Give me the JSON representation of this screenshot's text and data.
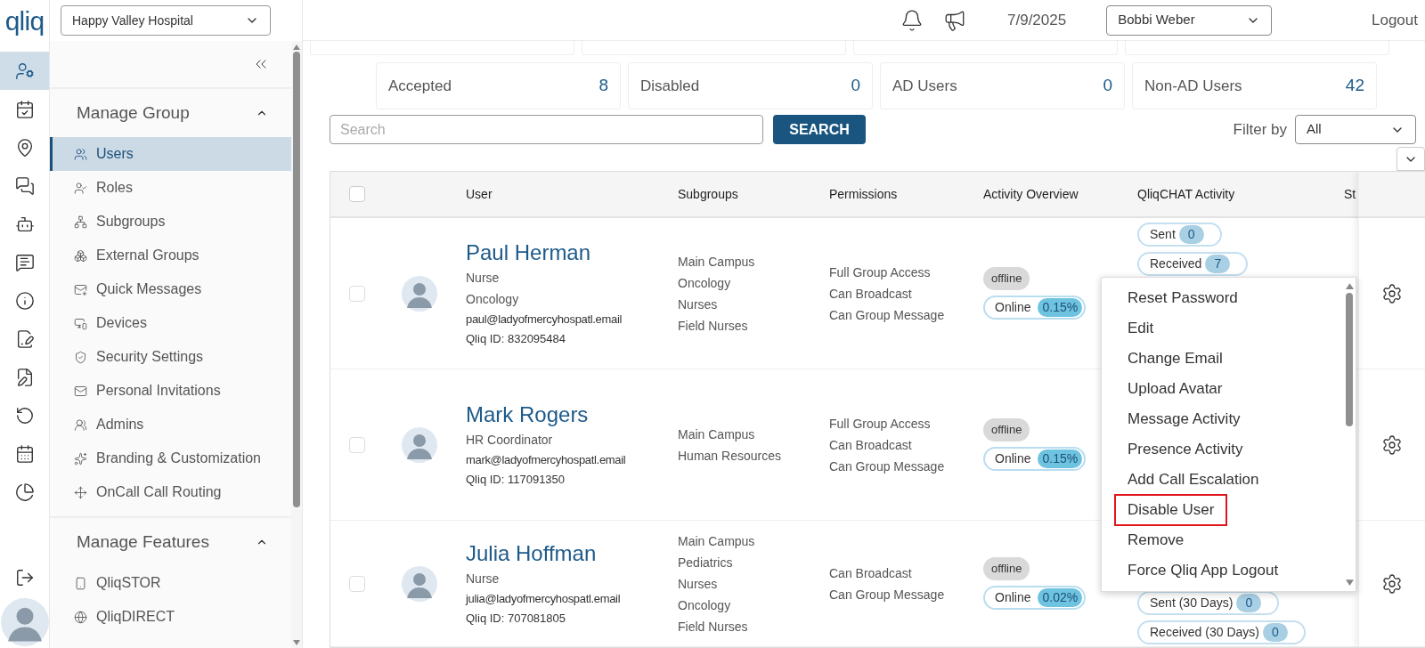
{
  "logo": "qliq",
  "rail_items": [
    {
      "selected": true
    },
    {
      "selected": false
    },
    {
      "selected": false
    },
    {
      "selected": false
    },
    {
      "selected": false
    },
    {
      "selected": false
    },
    {
      "selected": false
    },
    {
      "selected": false
    },
    {
      "selected": false
    },
    {
      "selected": false
    },
    {
      "selected": false
    },
    {
      "selected": false
    }
  ],
  "header": {
    "org_select": "Happy Valley Hospital",
    "date": "7/9/2025",
    "user_select": "Bobbi Weber",
    "logout": "Logout"
  },
  "sidebar": {
    "sections": [
      {
        "title": "Manage Group",
        "expanded": true,
        "items": [
          {
            "label": "Users",
            "selected": true
          },
          {
            "label": "Roles",
            "selected": false
          },
          {
            "label": "Subgroups",
            "selected": false
          },
          {
            "label": "External Groups",
            "selected": false
          },
          {
            "label": "Quick Messages",
            "selected": false
          },
          {
            "label": "Devices",
            "selected": false
          },
          {
            "label": "Security Settings",
            "selected": false
          },
          {
            "label": "Personal Invitations",
            "selected": false
          },
          {
            "label": "Admins",
            "selected": false
          },
          {
            "label": "Branding & Customization",
            "selected": false
          },
          {
            "label": "OnCall Call Routing",
            "selected": false
          }
        ]
      },
      {
        "title": "Manage Features",
        "expanded": true,
        "items": [
          {
            "label": "QliqSTOR",
            "selected": false
          },
          {
            "label": "QliqDIRECT",
            "selected": false
          }
        ]
      }
    ]
  },
  "stats": [
    {
      "label": "Accepted",
      "value": "8"
    },
    {
      "label": "Disabled",
      "value": "0"
    },
    {
      "label": "AD Users",
      "value": "0"
    },
    {
      "label": "Non-AD Users",
      "value": "42"
    }
  ],
  "search": {
    "placeholder": "Search",
    "button": "SEARCH"
  },
  "filter": {
    "label": "Filter by",
    "value": "All"
  },
  "table": {
    "select_all_checked": false,
    "columns": [
      "User",
      "Subgroups",
      "Permissions",
      "Activity Overview",
      "QliqCHAT Activity",
      "St"
    ],
    "rows": [
      {
        "checked": false,
        "name": "Paul Herman",
        "details": [
          "Nurse",
          "Oncology"
        ],
        "email": "paul@ladyofmercyhospatl.email",
        "qliq_id": "Qliq ID: 832095484",
        "subgroups": [
          "Main Campus",
          "Oncology",
          "Nurses",
          "Field Nurses"
        ],
        "permissions": [
          "Full Group Access",
          "Can Broadcast",
          "Can Group Message"
        ],
        "presence": "offline",
        "online_label": "Online",
        "online_pct": "0.15%",
        "chat": [
          {
            "label": "Sent",
            "count": "0"
          },
          {
            "label": "Received",
            "count": "7"
          }
        ]
      },
      {
        "checked": false,
        "name": "Mark Rogers",
        "details": [
          "HR Coordinator"
        ],
        "email": "mark@ladyofmercyhospatl.email",
        "qliq_id": "Qliq ID: 117091350",
        "subgroups": [
          "Main Campus",
          "Human Resources"
        ],
        "permissions": [
          "Full Group Access",
          "Can Broadcast",
          "Can Group Message"
        ],
        "presence": "offline",
        "online_label": "Online",
        "online_pct": "0.15%",
        "chat": []
      },
      {
        "checked": false,
        "name": "Julia Hoffman",
        "details": [
          "Nurse"
        ],
        "email": "julia@ladyofmercyhospatl.email",
        "qliq_id": "Qliq ID: 707081805",
        "subgroups": [
          "Main Campus",
          "Pediatrics",
          "Nurses",
          "Oncology",
          "Field Nurses"
        ],
        "permissions": [
          "Can Broadcast",
          "Can Group Message"
        ],
        "presence": "offline",
        "online_label": "Online",
        "online_pct": "0.02%",
        "chat": [
          {
            "label": "Sent (30 Days)",
            "count": "0"
          },
          {
            "label": "Received (30 Days)",
            "count": "0"
          }
        ]
      }
    ]
  },
  "menu": {
    "items": [
      {
        "label": "Reset Password",
        "highlighted": false
      },
      {
        "label": "Edit",
        "highlighted": false
      },
      {
        "label": "Change Email",
        "highlighted": false
      },
      {
        "label": "Upload Avatar",
        "highlighted": false
      },
      {
        "label": "Message Activity",
        "highlighted": false
      },
      {
        "label": "Presence Activity",
        "highlighted": false
      },
      {
        "label": "Add Call Escalation",
        "highlighted": false
      },
      {
        "label": "Disable User",
        "highlighted": true
      },
      {
        "label": "Remove",
        "highlighted": false
      },
      {
        "label": "Force Qliq App Logout",
        "highlighted": false
      }
    ]
  }
}
